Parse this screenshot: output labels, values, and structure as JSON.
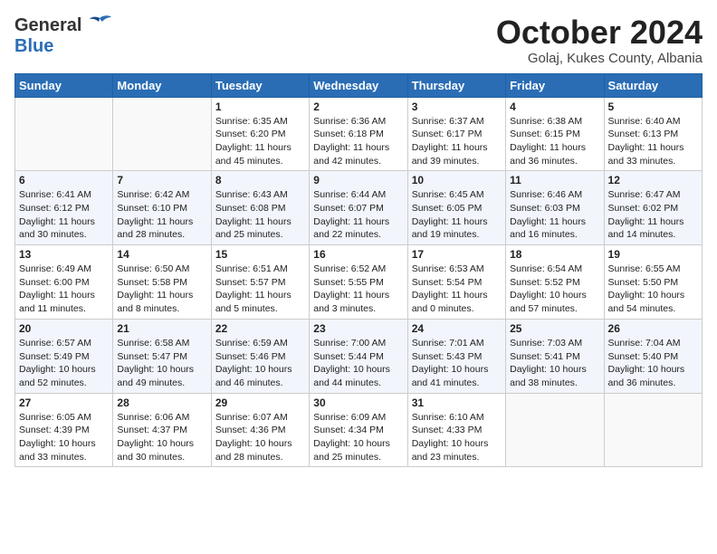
{
  "header": {
    "logo_general": "General",
    "logo_blue": "Blue",
    "month_title": "October 2024",
    "location": "Golaj, Kukes County, Albania"
  },
  "days_of_week": [
    "Sunday",
    "Monday",
    "Tuesday",
    "Wednesday",
    "Thursday",
    "Friday",
    "Saturday"
  ],
  "weeks": [
    [
      {
        "day": "",
        "data": ""
      },
      {
        "day": "",
        "data": ""
      },
      {
        "day": "1",
        "sunrise": "Sunrise: 6:35 AM",
        "sunset": "Sunset: 6:20 PM",
        "daylight": "Daylight: 11 hours and 45 minutes."
      },
      {
        "day": "2",
        "sunrise": "Sunrise: 6:36 AM",
        "sunset": "Sunset: 6:18 PM",
        "daylight": "Daylight: 11 hours and 42 minutes."
      },
      {
        "day": "3",
        "sunrise": "Sunrise: 6:37 AM",
        "sunset": "Sunset: 6:17 PM",
        "daylight": "Daylight: 11 hours and 39 minutes."
      },
      {
        "day": "4",
        "sunrise": "Sunrise: 6:38 AM",
        "sunset": "Sunset: 6:15 PM",
        "daylight": "Daylight: 11 hours and 36 minutes."
      },
      {
        "day": "5",
        "sunrise": "Sunrise: 6:40 AM",
        "sunset": "Sunset: 6:13 PM",
        "daylight": "Daylight: 11 hours and 33 minutes."
      }
    ],
    [
      {
        "day": "6",
        "sunrise": "Sunrise: 6:41 AM",
        "sunset": "Sunset: 6:12 PM",
        "daylight": "Daylight: 11 hours and 30 minutes."
      },
      {
        "day": "7",
        "sunrise": "Sunrise: 6:42 AM",
        "sunset": "Sunset: 6:10 PM",
        "daylight": "Daylight: 11 hours and 28 minutes."
      },
      {
        "day": "8",
        "sunrise": "Sunrise: 6:43 AM",
        "sunset": "Sunset: 6:08 PM",
        "daylight": "Daylight: 11 hours and 25 minutes."
      },
      {
        "day": "9",
        "sunrise": "Sunrise: 6:44 AM",
        "sunset": "Sunset: 6:07 PM",
        "daylight": "Daylight: 11 hours and 22 minutes."
      },
      {
        "day": "10",
        "sunrise": "Sunrise: 6:45 AM",
        "sunset": "Sunset: 6:05 PM",
        "daylight": "Daylight: 11 hours and 19 minutes."
      },
      {
        "day": "11",
        "sunrise": "Sunrise: 6:46 AM",
        "sunset": "Sunset: 6:03 PM",
        "daylight": "Daylight: 11 hours and 16 minutes."
      },
      {
        "day": "12",
        "sunrise": "Sunrise: 6:47 AM",
        "sunset": "Sunset: 6:02 PM",
        "daylight": "Daylight: 11 hours and 14 minutes."
      }
    ],
    [
      {
        "day": "13",
        "sunrise": "Sunrise: 6:49 AM",
        "sunset": "Sunset: 6:00 PM",
        "daylight": "Daylight: 11 hours and 11 minutes."
      },
      {
        "day": "14",
        "sunrise": "Sunrise: 6:50 AM",
        "sunset": "Sunset: 5:58 PM",
        "daylight": "Daylight: 11 hours and 8 minutes."
      },
      {
        "day": "15",
        "sunrise": "Sunrise: 6:51 AM",
        "sunset": "Sunset: 5:57 PM",
        "daylight": "Daylight: 11 hours and 5 minutes."
      },
      {
        "day": "16",
        "sunrise": "Sunrise: 6:52 AM",
        "sunset": "Sunset: 5:55 PM",
        "daylight": "Daylight: 11 hours and 3 minutes."
      },
      {
        "day": "17",
        "sunrise": "Sunrise: 6:53 AM",
        "sunset": "Sunset: 5:54 PM",
        "daylight": "Daylight: 11 hours and 0 minutes."
      },
      {
        "day": "18",
        "sunrise": "Sunrise: 6:54 AM",
        "sunset": "Sunset: 5:52 PM",
        "daylight": "Daylight: 10 hours and 57 minutes."
      },
      {
        "day": "19",
        "sunrise": "Sunrise: 6:55 AM",
        "sunset": "Sunset: 5:50 PM",
        "daylight": "Daylight: 10 hours and 54 minutes."
      }
    ],
    [
      {
        "day": "20",
        "sunrise": "Sunrise: 6:57 AM",
        "sunset": "Sunset: 5:49 PM",
        "daylight": "Daylight: 10 hours and 52 minutes."
      },
      {
        "day": "21",
        "sunrise": "Sunrise: 6:58 AM",
        "sunset": "Sunset: 5:47 PM",
        "daylight": "Daylight: 10 hours and 49 minutes."
      },
      {
        "day": "22",
        "sunrise": "Sunrise: 6:59 AM",
        "sunset": "Sunset: 5:46 PM",
        "daylight": "Daylight: 10 hours and 46 minutes."
      },
      {
        "day": "23",
        "sunrise": "Sunrise: 7:00 AM",
        "sunset": "Sunset: 5:44 PM",
        "daylight": "Daylight: 10 hours and 44 minutes."
      },
      {
        "day": "24",
        "sunrise": "Sunrise: 7:01 AM",
        "sunset": "Sunset: 5:43 PM",
        "daylight": "Daylight: 10 hours and 41 minutes."
      },
      {
        "day": "25",
        "sunrise": "Sunrise: 7:03 AM",
        "sunset": "Sunset: 5:41 PM",
        "daylight": "Daylight: 10 hours and 38 minutes."
      },
      {
        "day": "26",
        "sunrise": "Sunrise: 7:04 AM",
        "sunset": "Sunset: 5:40 PM",
        "daylight": "Daylight: 10 hours and 36 minutes."
      }
    ],
    [
      {
        "day": "27",
        "sunrise": "Sunrise: 6:05 AM",
        "sunset": "Sunset: 4:39 PM",
        "daylight": "Daylight: 10 hours and 33 minutes."
      },
      {
        "day": "28",
        "sunrise": "Sunrise: 6:06 AM",
        "sunset": "Sunset: 4:37 PM",
        "daylight": "Daylight: 10 hours and 30 minutes."
      },
      {
        "day": "29",
        "sunrise": "Sunrise: 6:07 AM",
        "sunset": "Sunset: 4:36 PM",
        "daylight": "Daylight: 10 hours and 28 minutes."
      },
      {
        "day": "30",
        "sunrise": "Sunrise: 6:09 AM",
        "sunset": "Sunset: 4:34 PM",
        "daylight": "Daylight: 10 hours and 25 minutes."
      },
      {
        "day": "31",
        "sunrise": "Sunrise: 6:10 AM",
        "sunset": "Sunset: 4:33 PM",
        "daylight": "Daylight: 10 hours and 23 minutes."
      },
      {
        "day": "",
        "data": ""
      },
      {
        "day": "",
        "data": ""
      }
    ]
  ]
}
